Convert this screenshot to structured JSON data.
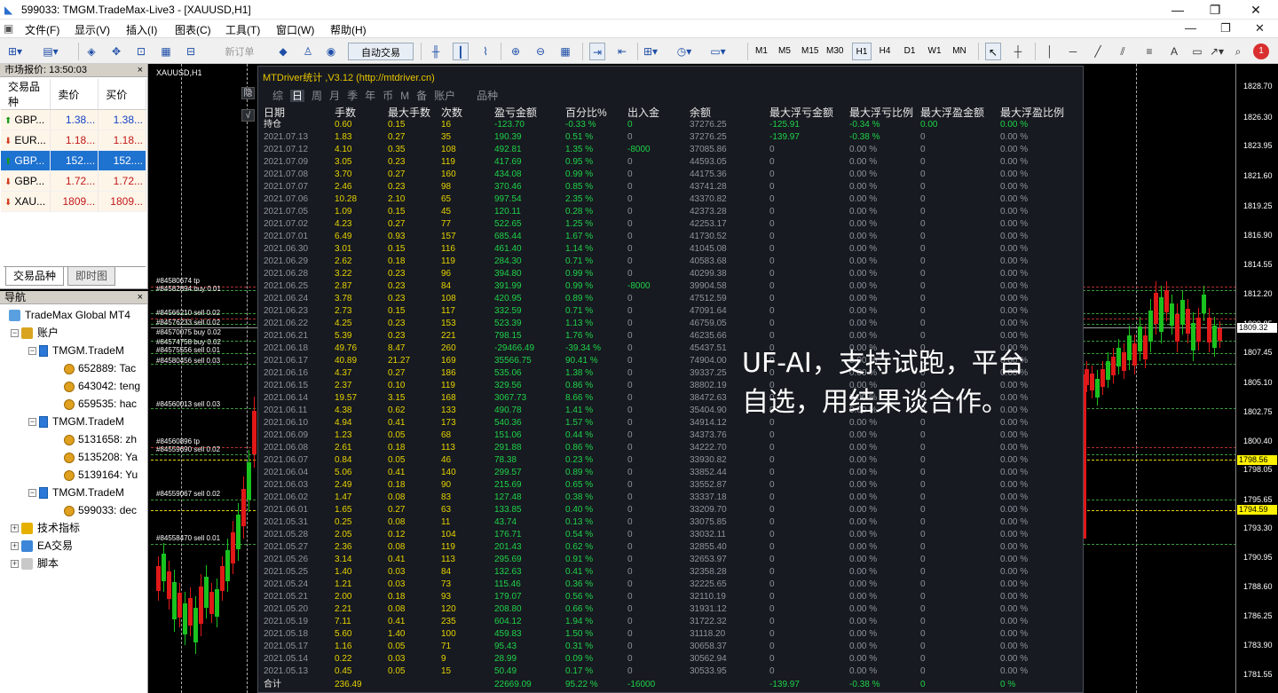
{
  "window": {
    "title": "599033: TMGM.TradeMax-Live3 - [XAUUSD,H1]",
    "min": "—",
    "max": "❐",
    "close": "✕"
  },
  "menu": [
    {
      "label": "文件(F)"
    },
    {
      "label": "显示(V)"
    },
    {
      "label": "插入(I)"
    },
    {
      "label": "图表(C)"
    },
    {
      "label": "工具(T)"
    },
    {
      "label": "窗口(W)"
    },
    {
      "label": "帮助(H)"
    }
  ],
  "menu_controls": {
    "min": "—",
    "restore": "❐",
    "close": "✕"
  },
  "toolbar": {
    "new_order": "新订单",
    "auto_trade": "自动交易",
    "timeframes": [
      "M1",
      "M5",
      "M15",
      "M30",
      "H1",
      "H4",
      "D1",
      "W1",
      "MN"
    ],
    "active_timeframe": "H1",
    "notifications": "1",
    "text_tool": "A"
  },
  "market_watch": {
    "title": "市场报价: 13:50:03",
    "headers": [
      "交易品种",
      "卖价",
      "买价"
    ],
    "rows": [
      {
        "symbol": "GBP...",
        "bid": "1.38...",
        "ask": "1.38...",
        "dir": "up"
      },
      {
        "symbol": "EUR...",
        "bid": "1.18...",
        "ask": "1.18...",
        "dir": "down"
      },
      {
        "symbol": "GBP...",
        "bid": "152....",
        "ask": "152....",
        "dir": "up",
        "selected": true
      },
      {
        "symbol": "GBP...",
        "bid": "1.72...",
        "ask": "1.72...",
        "dir": "down"
      },
      {
        "symbol": "XAU...",
        "bid": "1809...",
        "ask": "1809...",
        "dir": "down"
      }
    ],
    "tabs": [
      "交易品种",
      "即时图"
    ]
  },
  "navigator": {
    "title": "导航",
    "root": "TradeMax Global MT4",
    "accounts_label": "账户",
    "groups": [
      {
        "label": "TMGM.TradeM",
        "items": [
          "652889: Tac",
          "643042: teng",
          "659535: hac"
        ]
      },
      {
        "label": "TMGM.TradeM",
        "items": [
          "5131658: zh",
          "5135208: Ya",
          "5139164: Yu"
        ]
      },
      {
        "label": "TMGM.TradeM",
        "items": [
          "599033: dec"
        ]
      }
    ],
    "indicators": "技术指标",
    "ea": "EA交易",
    "scripts": "脚本"
  },
  "chart": {
    "symbol_label": "XAUUSD,H1",
    "prices": [
      "1828.70",
      "1826.30",
      "1823.95",
      "1821.60",
      "1819.25",
      "1816.90",
      "1814.55",
      "1812.20",
      "1809.85",
      "1807.45",
      "1805.10",
      "1802.75",
      "1800.40",
      "1798.05",
      "1795.65",
      "1793.30",
      "1790.95",
      "1788.60",
      "1786.25",
      "1783.90",
      "1781.55"
    ],
    "current_price": "1809.32",
    "yellow_1": "1798.56",
    "yellow_2": "1794.59",
    "order_labels": [
      "#84580674 tp",
      "#84582894 buy 0.01",
      "#84566210 sell 0.02",
      "#84576233 sell 0.02",
      "#84570075 buy 0.02",
      "#84574758 buy 0.02",
      "#84575556 sell 0.01",
      "#84580456 sell 0.03",
      "#84560013 sell 0.03",
      "#84560896 tp",
      "#84559690 sell 0.02",
      "#84559067 sell 0.02",
      "#84558470 sell 0.01"
    ],
    "side_buttons": [
      "隐",
      "√"
    ],
    "overlay_text": [
      "UF-AI，支持试跑，平台",
      "自选，用结果谈合作。"
    ]
  },
  "stats_panel": {
    "title": "MTDriver统计 ,V3.12 (http://mtdriver.cn)",
    "tabs": [
      "综",
      "日",
      "周",
      "月",
      "季",
      "年",
      "币",
      "M",
      "备",
      "账户",
      "",
      "",
      "品种"
    ],
    "active_tab": "日",
    "headers": [
      "日期",
      "手数",
      "最大手数",
      "次数",
      "盈亏金额",
      "百分比%",
      "出入金",
      "余额",
      "最大浮亏金额",
      "最大浮亏比例",
      "最大浮盈金额",
      "最大浮盈比例"
    ],
    "holding": [
      "持仓",
      "0.60",
      "0.15",
      "16",
      "-123.70",
      "-0.33 %",
      "0",
      "37276.25",
      "-125.91",
      "-0.34 %",
      "0.00",
      "0.00 %"
    ],
    "rows": [
      [
        "2021.07.13",
        "1.83",
        "0.27",
        "35",
        "190.39",
        "0.51 %",
        "0",
        "37276.25",
        "-139.97",
        "-0.38 %",
        "0",
        "0.00 %"
      ],
      [
        "2021.07.12",
        "4.10",
        "0.35",
        "108",
        "492.81",
        "1.35 %",
        "-8000",
        "37085.86",
        "0",
        "0.00 %",
        "0",
        "0.00 %"
      ],
      [
        "2021.07.09",
        "3.05",
        "0.23",
        "119",
        "417.69",
        "0.95 %",
        "0",
        "44593.05",
        "0",
        "0.00 %",
        "0",
        "0.00 %"
      ],
      [
        "2021.07.08",
        "3.70",
        "0.27",
        "160",
        "434.08",
        "0.99 %",
        "0",
        "44175.36",
        "0",
        "0.00 %",
        "0",
        "0.00 %"
      ],
      [
        "2021.07.07",
        "2.46",
        "0.23",
        "98",
        "370.46",
        "0.85 %",
        "0",
        "43741.28",
        "0",
        "0.00 %",
        "0",
        "0.00 %"
      ],
      [
        "2021.07.06",
        "10.28",
        "2.10",
        "65",
        "997.54",
        "2.35 %",
        "0",
        "43370.82",
        "0",
        "0.00 %",
        "0",
        "0.00 %"
      ],
      [
        "2021.07.05",
        "1.09",
        "0.15",
        "45",
        "120.11",
        "0.28 %",
        "0",
        "42373.28",
        "0",
        "0.00 %",
        "0",
        "0.00 %"
      ],
      [
        "2021.07.02",
        "4.23",
        "0.27",
        "77",
        "522.65",
        "1.25 %",
        "0",
        "42253.17",
        "0",
        "0.00 %",
        "0",
        "0.00 %"
      ],
      [
        "2021.07.01",
        "6.49",
        "0.93",
        "157",
        "685.44",
        "1.67 %",
        "0",
        "41730.52",
        "0",
        "0.00 %",
        "0",
        "0.00 %"
      ],
      [
        "2021.06.30",
        "3.01",
        "0.15",
        "116",
        "461.40",
        "1.14 %",
        "0",
        "41045.08",
        "0",
        "0.00 %",
        "0",
        "0.00 %"
      ],
      [
        "2021.06.29",
        "2.62",
        "0.18",
        "119",
        "284.30",
        "0.71 %",
        "0",
        "40583.68",
        "0",
        "0.00 %",
        "0",
        "0.00 %"
      ],
      [
        "2021.06.28",
        "3.22",
        "0.23",
        "96",
        "394.80",
        "0.99 %",
        "0",
        "40299.38",
        "0",
        "0.00 %",
        "0",
        "0.00 %"
      ],
      [
        "2021.06.25",
        "2.87",
        "0.23",
        "84",
        "391.99",
        "0.99 %",
        "-8000",
        "39904.58",
        "0",
        "0.00 %",
        "0",
        "0.00 %"
      ],
      [
        "2021.06.24",
        "3.78",
        "0.23",
        "108",
        "420.95",
        "0.89 %",
        "0",
        "47512.59",
        "0",
        "0.00 %",
        "0",
        "0.00 %"
      ],
      [
        "2021.06.23",
        "2.73",
        "0.15",
        "117",
        "332.59",
        "0.71 %",
        "0",
        "47091.64",
        "0",
        "0.00 %",
        "0",
        "0.00 %"
      ],
      [
        "2021.06.22",
        "4.25",
        "0.23",
        "153",
        "523.39",
        "1.13 %",
        "0",
        "46759.05",
        "0",
        "0.00 %",
        "0",
        "0.00 %"
      ],
      [
        "2021.06.21",
        "5.39",
        "0.23",
        "221",
        "798.15",
        "1.76 %",
        "0",
        "46235.66",
        "0",
        "0.00 %",
        "0",
        "0.00 %"
      ],
      [
        "2021.06.18",
        "49.76",
        "8.47",
        "260",
        "-29466.49",
        "-39.34 %",
        "0",
        "45437.51",
        "0",
        "0.00 %",
        "0",
        "0.00 %"
      ],
      [
        "2021.06.17",
        "40.89",
        "21.27",
        "169",
        "35566.75",
        "90.41 %",
        "0",
        "74904.00",
        "0",
        "0.00 %",
        "0",
        "0.00 %"
      ],
      [
        "2021.06.16",
        "4.37",
        "0.27",
        "186",
        "535.06",
        "1.38 %",
        "0",
        "39337.25",
        "0",
        "0.00 %",
        "0",
        "0.00 %"
      ],
      [
        "2021.06.15",
        "2.37",
        "0.10",
        "119",
        "329.56",
        "0.86 %",
        "0",
        "38802.19",
        "0",
        "0.00 %",
        "0",
        "0.00 %"
      ],
      [
        "2021.06.14",
        "19.57",
        "3.15",
        "168",
        "3067.73",
        "8.66 %",
        "0",
        "38472.63",
        "0",
        "0.00 %",
        "0",
        "0.00 %"
      ],
      [
        "2021.06.11",
        "4.38",
        "0.62",
        "133",
        "490.78",
        "1.41 %",
        "0",
        "35404.90",
        "0",
        "0.00 %",
        "0",
        "0.00 %"
      ],
      [
        "2021.06.10",
        "4.94",
        "0.41",
        "173",
        "540.36",
        "1.57 %",
        "0",
        "34914.12",
        "0",
        "0.00 %",
        "0",
        "0.00 %"
      ],
      [
        "2021.06.09",
        "1.23",
        "0.05",
        "68",
        "151.06",
        "0.44 %",
        "0",
        "34373.76",
        "0",
        "0.00 %",
        "0",
        "0.00 %"
      ],
      [
        "2021.06.08",
        "2.61",
        "0.18",
        "113",
        "291.88",
        "0.86 %",
        "0",
        "34222.70",
        "0",
        "0.00 %",
        "0",
        "0.00 %"
      ],
      [
        "2021.06.07",
        "0.84",
        "0.05",
        "46",
        "78.38",
        "0.23 %",
        "0",
        "33930.82",
        "0",
        "0.00 %",
        "0",
        "0.00 %"
      ],
      [
        "2021.06.04",
        "5.06",
        "0.41",
        "140",
        "299.57",
        "0.89 %",
        "0",
        "33852.44",
        "0",
        "0.00 %",
        "0",
        "0.00 %"
      ],
      [
        "2021.06.03",
        "2.49",
        "0.18",
        "90",
        "215.69",
        "0.65 %",
        "0",
        "33552.87",
        "0",
        "0.00 %",
        "0",
        "0.00 %"
      ],
      [
        "2021.06.02",
        "1.47",
        "0.08",
        "83",
        "127.48",
        "0.38 %",
        "0",
        "33337.18",
        "0",
        "0.00 %",
        "0",
        "0.00 %"
      ],
      [
        "2021.06.01",
        "1.65",
        "0.27",
        "63",
        "133.85",
        "0.40 %",
        "0",
        "33209.70",
        "0",
        "0.00 %",
        "0",
        "0.00 %"
      ],
      [
        "2021.05.31",
        "0.25",
        "0.08",
        "11",
        "43.74",
        "0.13 %",
        "0",
        "33075.85",
        "0",
        "0.00 %",
        "0",
        "0.00 %"
      ],
      [
        "2021.05.28",
        "2.05",
        "0.12",
        "104",
        "176.71",
        "0.54 %",
        "0",
        "33032.11",
        "0",
        "0.00 %",
        "0",
        "0.00 %"
      ],
      [
        "2021.05.27",
        "2.36",
        "0.08",
        "119",
        "201.43",
        "0.62 %",
        "0",
        "32855.40",
        "0",
        "0.00 %",
        "0",
        "0.00 %"
      ],
      [
        "2021.05.26",
        "3.14",
        "0.41",
        "113",
        "295.69",
        "0.91 %",
        "0",
        "32653.97",
        "0",
        "0.00 %",
        "0",
        "0.00 %"
      ],
      [
        "2021.05.25",
        "1.40",
        "0.03",
        "84",
        "132.63",
        "0.41 %",
        "0",
        "32358.28",
        "0",
        "0.00 %",
        "0",
        "0.00 %"
      ],
      [
        "2021.05.24",
        "1.21",
        "0.03",
        "73",
        "115.46",
        "0.36 %",
        "0",
        "32225.65",
        "0",
        "0.00 %",
        "0",
        "0.00 %"
      ],
      [
        "2021.05.21",
        "2.00",
        "0.18",
        "93",
        "179.07",
        "0.56 %",
        "0",
        "32110.19",
        "0",
        "0.00 %",
        "0",
        "0.00 %"
      ],
      [
        "2021.05.20",
        "2.21",
        "0.08",
        "120",
        "208.80",
        "0.66 %",
        "0",
        "31931.12",
        "0",
        "0.00 %",
        "0",
        "0.00 %"
      ],
      [
        "2021.05.19",
        "7.11",
        "0.41",
        "235",
        "604.12",
        "1.94 %",
        "0",
        "31722.32",
        "0",
        "0.00 %",
        "0",
        "0.00 %"
      ],
      [
        "2021.05.18",
        "5.60",
        "1.40",
        "100",
        "459.83",
        "1.50 %",
        "0",
        "31118.20",
        "0",
        "0.00 %",
        "0",
        "0.00 %"
      ],
      [
        "2021.05.17",
        "1.16",
        "0.05",
        "71",
        "95.43",
        "0.31 %",
        "0",
        "30658.37",
        "0",
        "0.00 %",
        "0",
        "0.00 %"
      ],
      [
        "2021.05.14",
        "0.22",
        "0.03",
        "9",
        "28.99",
        "0.09 %",
        "0",
        "30562.94",
        "0",
        "0.00 %",
        "0",
        "0.00 %"
      ],
      [
        "2021.05.13",
        "0.45",
        "0.05",
        "15",
        "50.49",
        "0.17 %",
        "0",
        "30533.95",
        "0",
        "0.00 %",
        "0",
        "0.00 %"
      ]
    ],
    "total": [
      "合计",
      "236.49",
      "",
      "",
      "22669.09",
      "95.22 %",
      "-16000",
      "",
      "-139.97",
      "-0.38 %",
      "0",
      "0 %"
    ]
  },
  "colors": {
    "accent": "#1e72d0",
    "yellow": "#e6d200",
    "green": "#1fd24a",
    "up": "#19c21e",
    "down": "#e01818"
  }
}
